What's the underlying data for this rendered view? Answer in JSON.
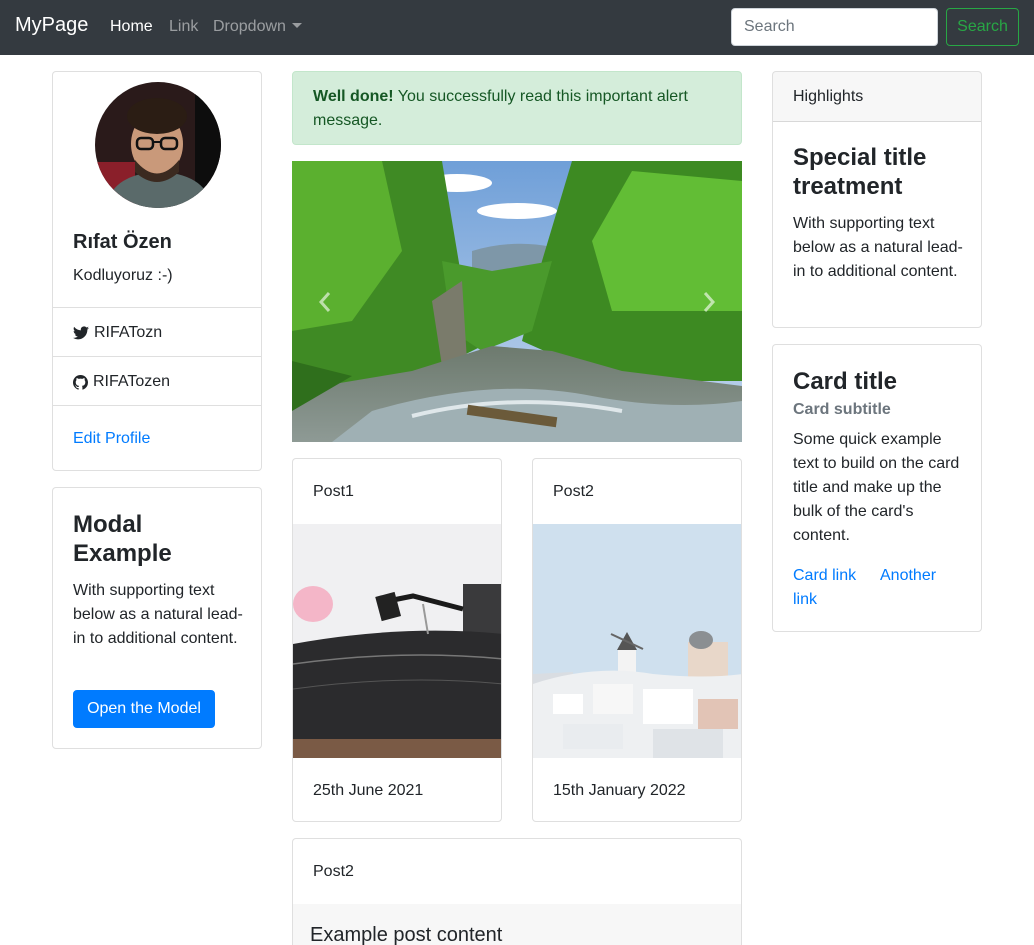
{
  "navbar": {
    "brand": "MyPage",
    "links": [
      {
        "label": "Home",
        "active": true
      },
      {
        "label": "Link",
        "active": false
      },
      {
        "label": "Dropdown",
        "active": false
      }
    ],
    "search_placeholder": "Search",
    "search_button": "Search"
  },
  "profile": {
    "name": "Rıfat Özen",
    "bio": "Kodluyoruz :-)",
    "twitter": "RIFATozn",
    "github": "RIFATozen",
    "edit_link": "Edit Profile"
  },
  "modal_card": {
    "title": "Modal Example",
    "text": "With supporting text below as a natural lead-in to additional content.",
    "button": "Open the Model"
  },
  "alert": {
    "strong": "Well done!",
    "text": "You successfully read this important alert message."
  },
  "posts": [
    {
      "title": "Post1",
      "date": "25th June 2021"
    },
    {
      "title": "Post2",
      "date": "15th January 2022"
    }
  ],
  "wide_post": {
    "title": "Post2",
    "content": "Example post content"
  },
  "highlights": {
    "header": "Highlights",
    "title": "Special title treatment",
    "text": "With supporting text below as a natural lead-in to additional content."
  },
  "info_card": {
    "title": "Card title",
    "subtitle": "Card subtitle",
    "text": "Some quick example text to build on the card title and make up the bulk of the card's content.",
    "link1": "Card link",
    "link2": "Another link"
  },
  "colors": {
    "navbar_bg": "#343a40",
    "primary": "#007bff",
    "success": "#28a745",
    "alert_bg": "#d4edda",
    "alert_text": "#155724"
  },
  "icons": [
    "twitter-icon",
    "github-icon",
    "chevron-left-icon",
    "chevron-right-icon",
    "caret-down-icon"
  ]
}
